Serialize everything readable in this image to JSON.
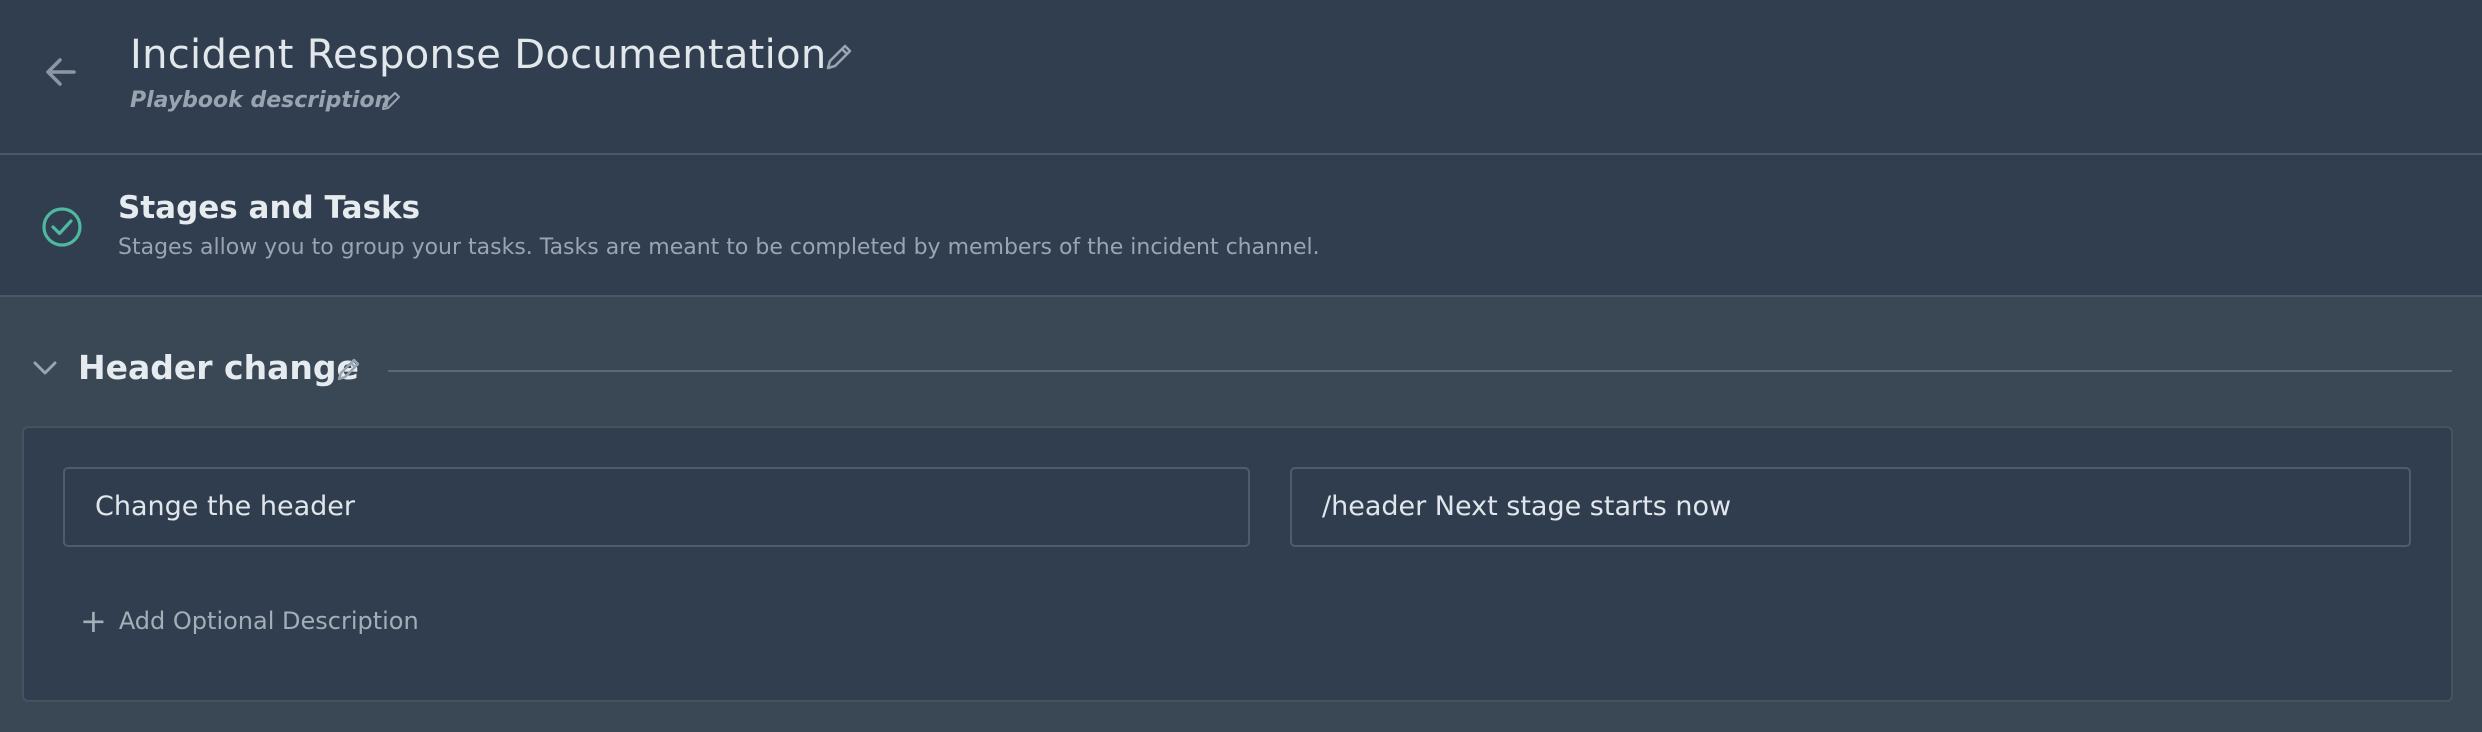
{
  "page": {
    "title": "Incident Response Documentation",
    "description": "Playbook description"
  },
  "section": {
    "title": "Stages and Tasks",
    "subtitle": "Stages allow you to group your tasks. Tasks are meant to be completed by members of the incident channel."
  },
  "stage": {
    "title": "Header change",
    "task": {
      "name_value": "Change the header",
      "command_value": "/header Next stage starts now",
      "add_description_label": "Add Optional Description"
    }
  },
  "icons": {
    "back": "arrow-left-icon",
    "edit": "pencil-icon",
    "section": "check-circle-icon",
    "collapse": "chevron-down-icon",
    "add": "plus-icon"
  },
  "colors": {
    "background": "#2f3d4e",
    "content_background": "#3a4856",
    "accent_check": "#4fb8a0",
    "text_primary": "#e2e7ec",
    "text_secondary": "#9aa4b0"
  }
}
